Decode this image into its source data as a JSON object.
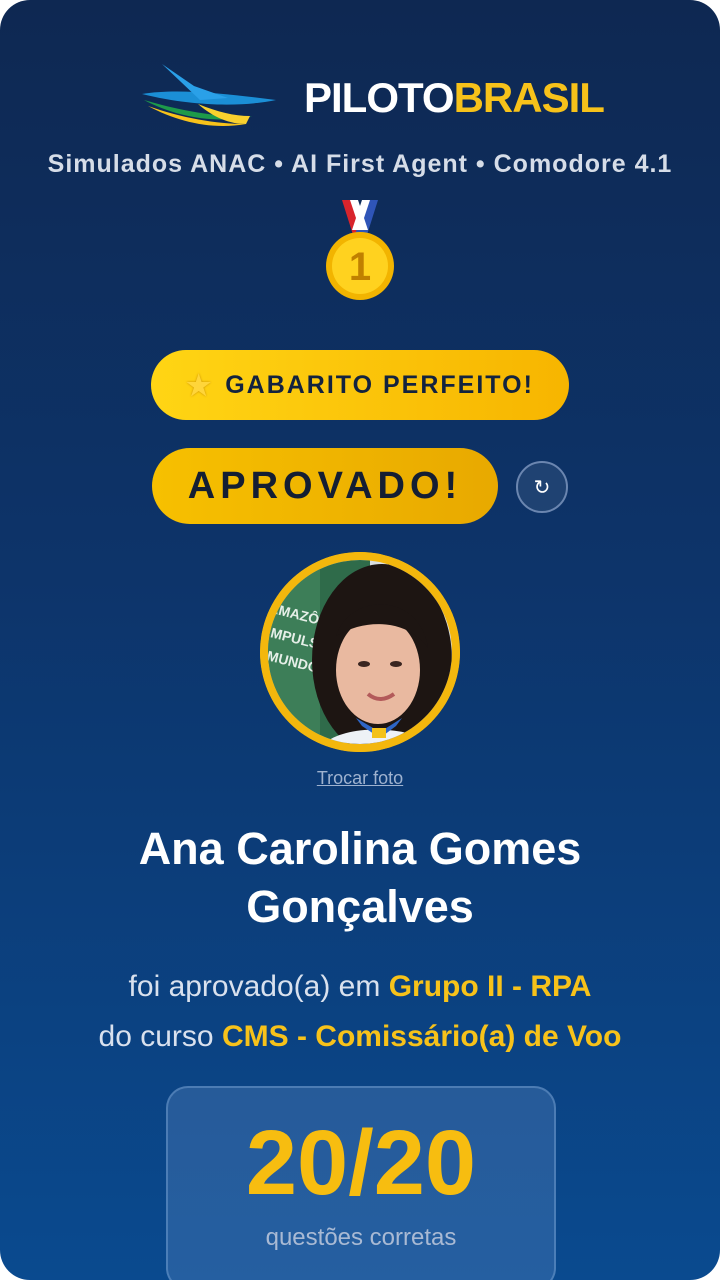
{
  "brand": {
    "name_part1": "PILOTO",
    "name_part2": "BRASIL"
  },
  "subtitle": "Simulados ANAC • AI First Agent • Comodore 4.1",
  "medal": {
    "icon": "first-place-medal-icon",
    "number": "1"
  },
  "badges": {
    "perfect_label": "GABARITO PERFEITO!",
    "perfect_icon": "star-icon",
    "approved_label": "APROVADO!",
    "refresh_icon": "↻"
  },
  "profile": {
    "change_photo": "Trocar foto",
    "name": "Ana Carolina Gomes Gonçalves"
  },
  "result": {
    "line1_prefix": "foi aprovado(a) em ",
    "group": "Grupo II - RPA",
    "line2_prefix": "do curso ",
    "course": "CMS - Comissário(a) de Voo"
  },
  "score": {
    "value": "20/20",
    "label": "questões corretas"
  },
  "colors": {
    "accent": "#f7c21a",
    "background": "#0d346a"
  }
}
